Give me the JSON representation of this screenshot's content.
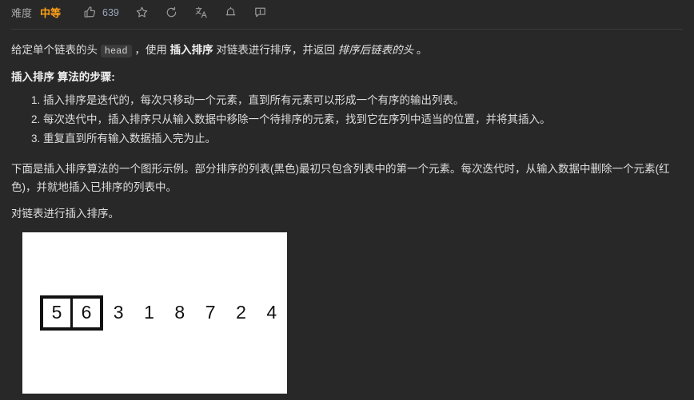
{
  "topbar": {
    "difficulty_label": "难度",
    "difficulty_value": "中等",
    "difficulty_color": "#ffa116",
    "like_count": "639",
    "icons": {
      "thumbs_up": "thumbs-up-icon",
      "star": "star-icon",
      "refresh": "refresh-icon",
      "translate": "translate-icon",
      "bell": "bell-icon",
      "feedback": "feedback-icon"
    }
  },
  "content": {
    "intro": {
      "part1": "给定单个链表的头 ",
      "code": "head",
      "part2": " ，使用 ",
      "bold1": "插入排序",
      "part3": " 对链表进行排序，并返回 ",
      "italic1": "排序后链表的头",
      "part4": " 。"
    },
    "steps_heading": {
      "bold": "插入排序",
      "rest": " 算法的步骤:"
    },
    "steps": [
      "插入排序是迭代的，每次只移动一个元素，直到所有元素可以形成一个有序的输出列表。",
      "每次迭代中，插入排序只从输入数据中移除一个待排序的元素，找到它在序列中适当的位置，并将其插入。",
      "重复直到所有输入数据插入完为止。"
    ],
    "description": "下面是插入排序算法的一个图形示例。部分排序的列表(黑色)最初只包含列表中的第一个元素。每次迭代时，从输入数据中删除一个元素(红色)，并就地插入已排序的列表中。",
    "caption": "对链表进行插入排序。"
  },
  "figure": {
    "sorted_cells": [
      "5",
      "6"
    ],
    "unsorted_values": [
      "3",
      "1",
      "8",
      "7",
      "2",
      "4"
    ],
    "background": "#ffffff",
    "ink": "#111111"
  }
}
